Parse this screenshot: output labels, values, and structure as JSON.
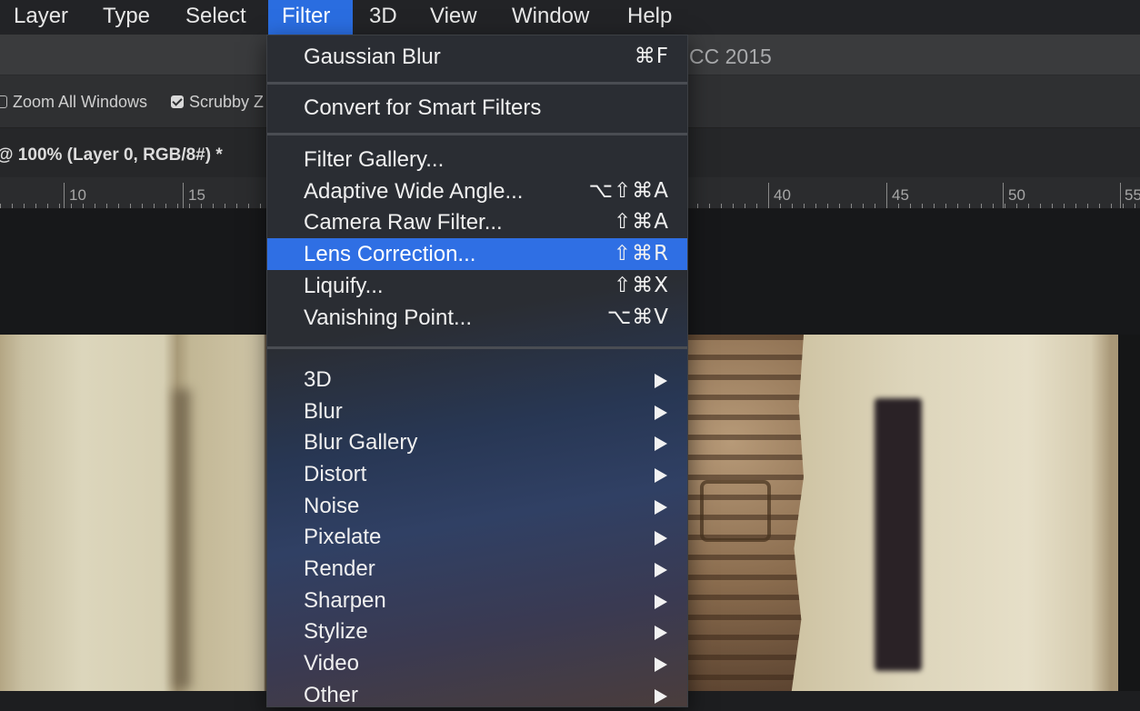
{
  "menubar": {
    "items": [
      {
        "label": "Layer",
        "left": 0
      },
      {
        "label": "Type"
      },
      {
        "label": "Select"
      },
      {
        "label": "Filter",
        "active": true
      },
      {
        "label": "3D"
      },
      {
        "label": "View"
      },
      {
        "label": "Window"
      },
      {
        "label": "Help"
      }
    ]
  },
  "window": {
    "title_fragment": "CC 2015"
  },
  "options_bar": {
    "zoom_all_windows": {
      "label": "Zoom All Windows",
      "checked": false
    },
    "scrubby": {
      "label": "Scrubby Z",
      "checked": true
    }
  },
  "document_tab": {
    "label": "@ 100% (Layer 0, RGB/8#) *"
  },
  "ruler": {
    "labels": [
      "10",
      "15",
      "40",
      "45",
      "50",
      "55"
    ]
  },
  "filter_menu": {
    "top_items": [
      {
        "label": "Gaussian Blur",
        "shortcut": "⌘F"
      }
    ],
    "smart_items": [
      {
        "label": "Convert for Smart Filters",
        "shortcut": ""
      }
    ],
    "gallery_items": [
      {
        "label": "Filter Gallery...",
        "shortcut": ""
      },
      {
        "label": "Adaptive Wide Angle...",
        "shortcut": "⌥⇧⌘A"
      },
      {
        "label": "Camera Raw Filter...",
        "shortcut": "⇧⌘A"
      },
      {
        "label": "Lens Correction...",
        "shortcut": "⇧⌘R",
        "highlighted": true
      },
      {
        "label": "Liquify...",
        "shortcut": "⇧⌘X"
      },
      {
        "label": "Vanishing Point...",
        "shortcut": "⌥⌘V"
      }
    ],
    "submenus": [
      {
        "label": "3D"
      },
      {
        "label": "Blur"
      },
      {
        "label": "Blur Gallery"
      },
      {
        "label": "Distort"
      },
      {
        "label": "Noise"
      },
      {
        "label": "Pixelate"
      },
      {
        "label": "Render"
      },
      {
        "label": "Sharpen"
      },
      {
        "label": "Stylize"
      },
      {
        "label": "Video"
      },
      {
        "label": "Other"
      }
    ]
  }
}
